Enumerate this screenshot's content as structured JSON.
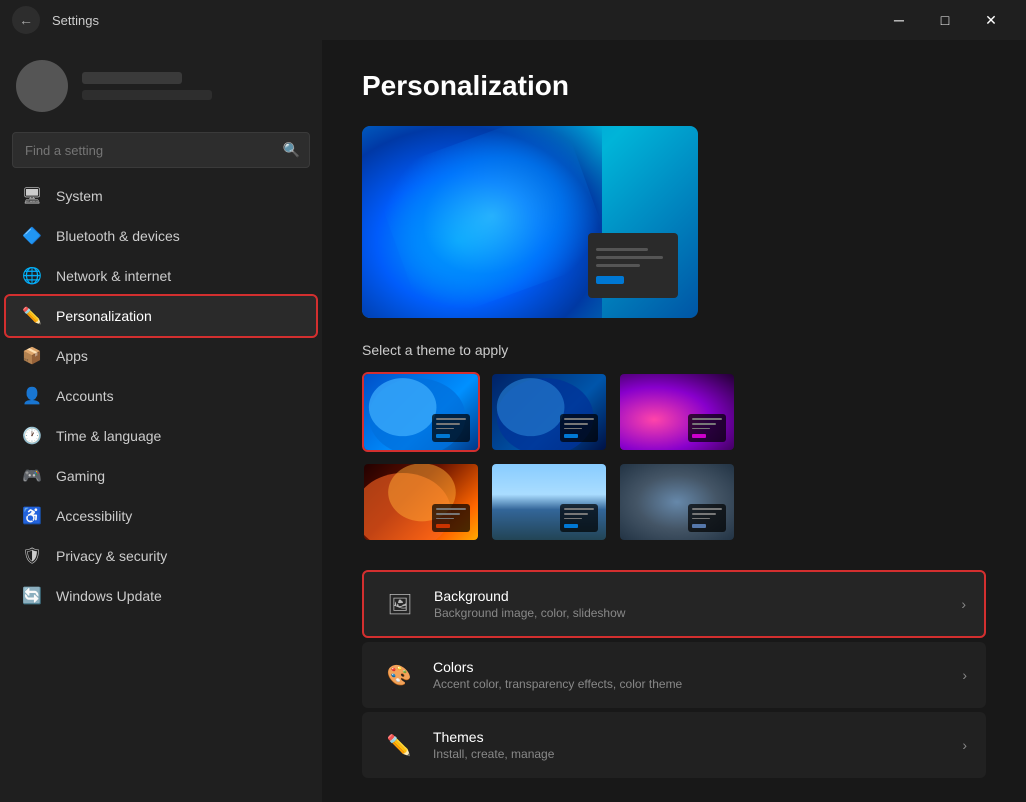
{
  "titlebar": {
    "app_title": "Settings",
    "back_label": "←",
    "min_label": "─",
    "max_label": "□",
    "close_label": "✕"
  },
  "search": {
    "placeholder": "Find a setting"
  },
  "nav": {
    "items": [
      {
        "id": "system",
        "label": "System",
        "icon": "🖥"
      },
      {
        "id": "bluetooth",
        "label": "Bluetooth & devices",
        "icon": "🔷"
      },
      {
        "id": "network",
        "label": "Network & internet",
        "icon": "🌐"
      },
      {
        "id": "personalization",
        "label": "Personalization",
        "icon": "✏️",
        "active": true
      },
      {
        "id": "apps",
        "label": "Apps",
        "icon": "📦"
      },
      {
        "id": "accounts",
        "label": "Accounts",
        "icon": "👤"
      },
      {
        "id": "time",
        "label": "Time & language",
        "icon": "🕐"
      },
      {
        "id": "gaming",
        "label": "Gaming",
        "icon": "🎮"
      },
      {
        "id": "accessibility",
        "label": "Accessibility",
        "icon": "♿"
      },
      {
        "id": "privacy",
        "label": "Privacy & security",
        "icon": "🛡"
      },
      {
        "id": "update",
        "label": "Windows Update",
        "icon": "🔄"
      }
    ]
  },
  "content": {
    "title": "Personalization",
    "select_theme_label": "Select a theme to apply",
    "settings_items": [
      {
        "id": "background",
        "title": "Background",
        "desc": "Background image, color, slideshow",
        "highlighted": true
      },
      {
        "id": "colors",
        "title": "Colors",
        "desc": "Accent color, transparency effects, color theme",
        "highlighted": false
      },
      {
        "id": "themes",
        "title": "Themes",
        "desc": "Install, create, manage",
        "highlighted": false
      }
    ],
    "themes": [
      {
        "id": "theme1",
        "selected": true,
        "color1": "#0050c8",
        "color2": "#0090ff"
      },
      {
        "id": "theme2",
        "selected": false,
        "color1": "#003888",
        "color2": "#0070dd"
      },
      {
        "id": "theme3",
        "selected": false,
        "color1": "#6b006b",
        "color2": "#cc00cc"
      },
      {
        "id": "theme4",
        "selected": false,
        "color1": "#8b0000",
        "color2": "#ff6633"
      },
      {
        "id": "theme5",
        "selected": false,
        "color1": "#004488",
        "color2": "#88ccff"
      },
      {
        "id": "theme6",
        "selected": false,
        "color1": "#333344",
        "color2": "#8899bb"
      }
    ]
  }
}
